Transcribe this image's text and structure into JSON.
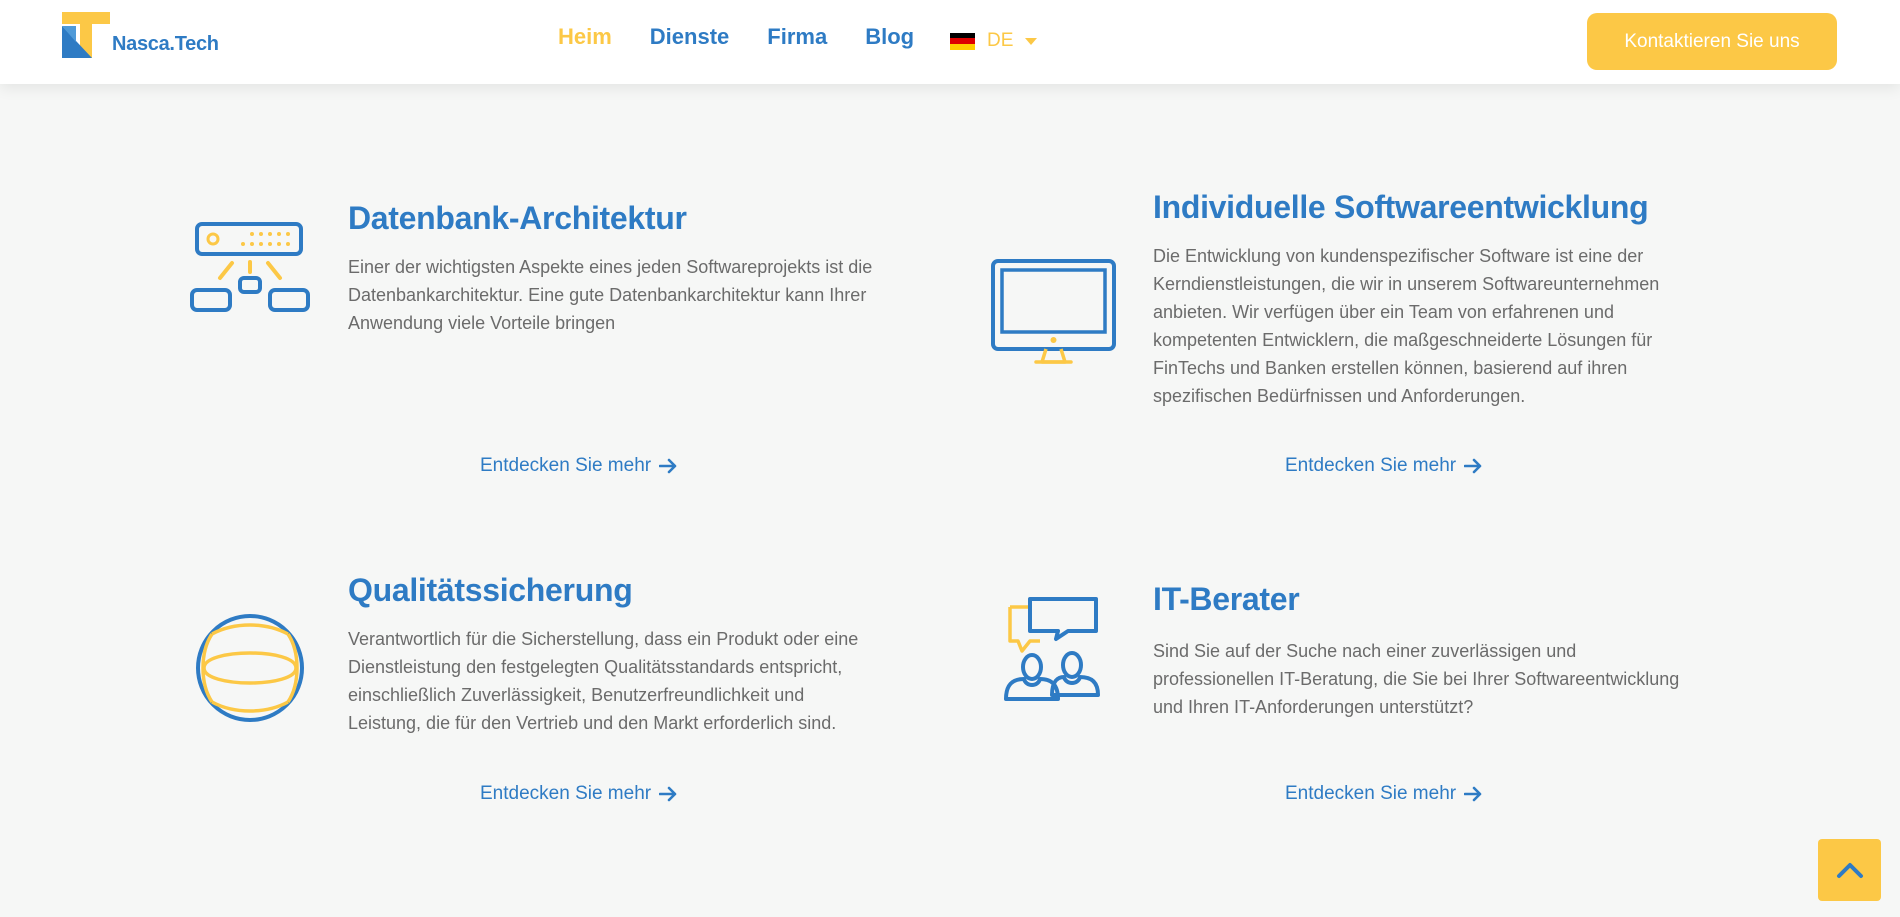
{
  "header": {
    "logo_text": "Nasca.Tech",
    "nav": [
      {
        "label": "Heim",
        "active": true
      },
      {
        "label": "Dienste",
        "active": false
      },
      {
        "label": "Firma",
        "active": false
      },
      {
        "label": "Blog",
        "active": false
      }
    ],
    "language": {
      "code": "DE",
      "flag_colors": [
        "#000000",
        "#dd0000",
        "#ffce00"
      ]
    },
    "cta_label": "Kontaktieren Sie uns"
  },
  "services": [
    {
      "icon": "database-architecture-icon",
      "title": "Datenbank-Architektur",
      "text": "Einer der wichtigsten Aspekte eines jeden Softwareprojekts ist die Datenbankarchitektur. Eine gute Datenbankarchitektur kann Ihrer Anwendung viele Vorteile bringen",
      "link": "Entdecken Sie mehr"
    },
    {
      "icon": "monitor-icon",
      "title": "Individuelle Softwareentwicklung",
      "text": "Die Entwicklung von kundenspezifischer Software ist eine der Kerndienstleistungen, die wir in unserem Softwareunternehmen anbieten. Wir verfügen über ein Team von erfahrenen und kompetenten Entwicklern, die maßgeschneiderte Lösungen für FinTechs und Banken erstellen können, basierend auf ihren spezifischen Bedürfnissen und Anforderungen.",
      "link": "Entdecken Sie mehr"
    },
    {
      "icon": "quality-sphere-icon",
      "title": "Qualitätssicherung",
      "text": "Verantwortlich für die Sicherstellung, dass ein Produkt oder eine Dienstleistung den festgelegten Qualitätsstandards entspricht, einschließlich Zuverlässigkeit, Benutzerfreundlichkeit und Leistung, die für den Vertrieb und den Markt erforderlich sind.",
      "link": "Entdecken Sie mehr"
    },
    {
      "icon": "consultants-chat-icon",
      "title": "IT-Berater",
      "text": "Sind Sie auf der Suche nach einer zuverlässigen und professionellen IT-Beratung, die Sie bei Ihrer Softwareentwicklung und Ihren IT-Anforderungen unterstützt?",
      "link": "Entdecken Sie mehr"
    }
  ],
  "colors": {
    "primary": "#2e7bc4",
    "accent": "#fcc846",
    "text": "#6b6b6b",
    "background": "#f6f7f6"
  },
  "scroll_top_icon": "chevron-up-icon"
}
